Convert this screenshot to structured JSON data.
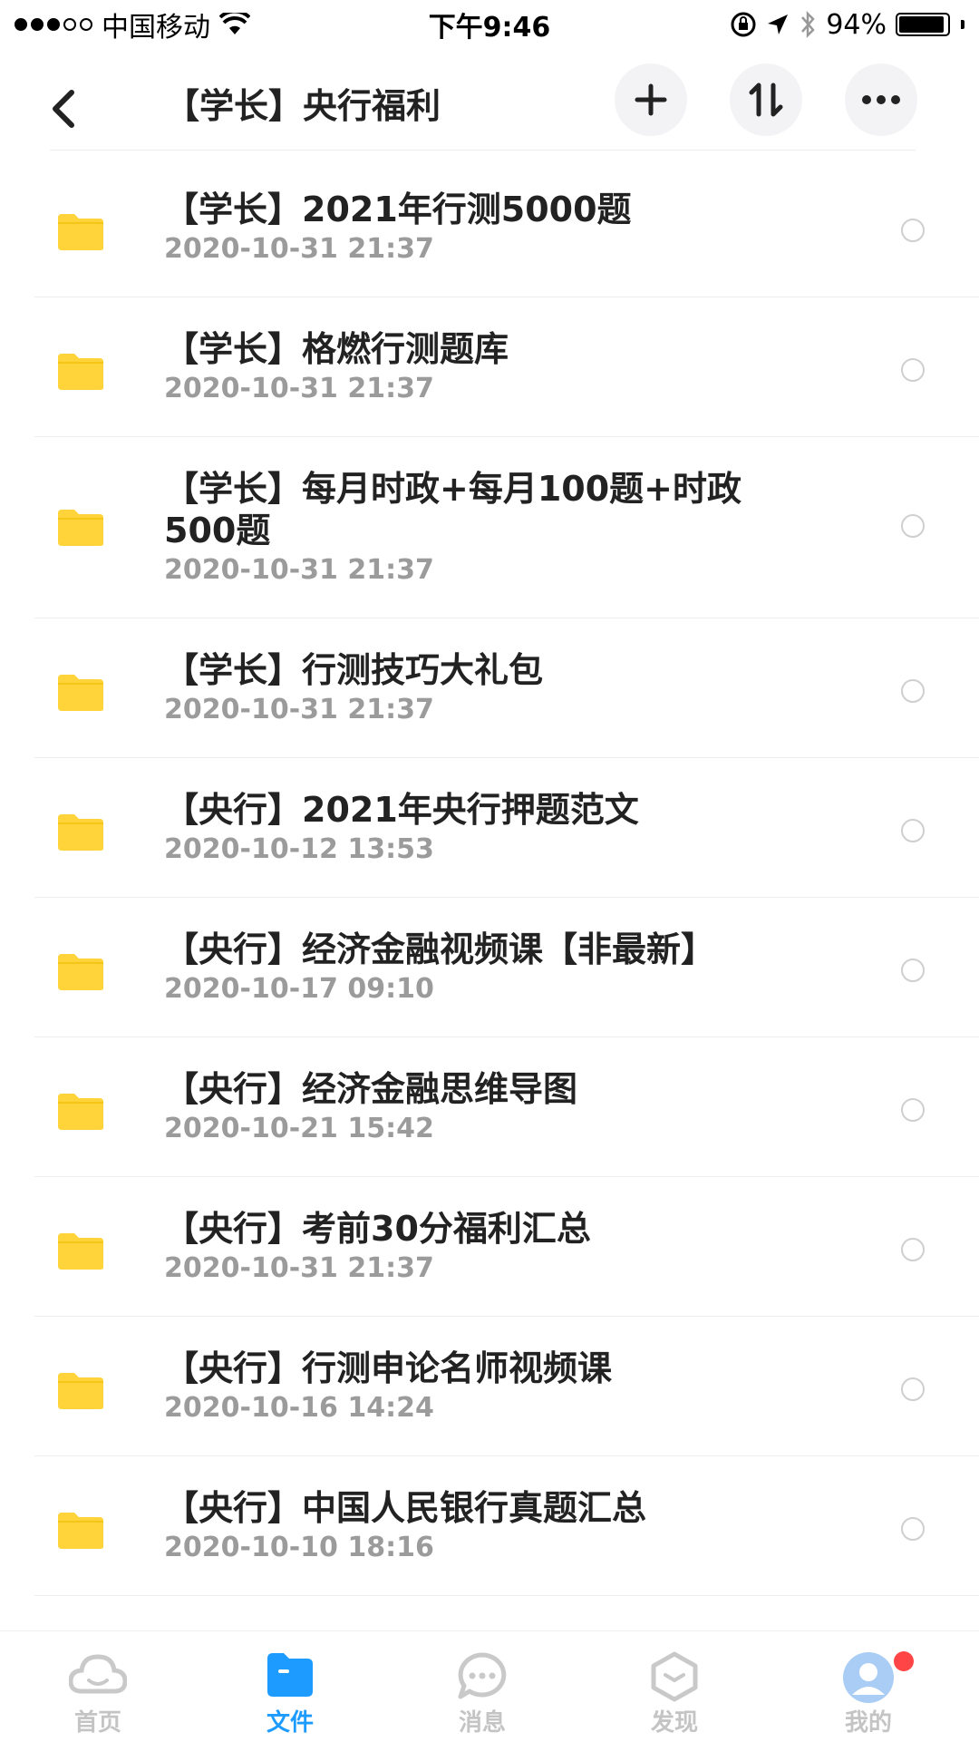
{
  "status_bar": {
    "carrier": "中国移动",
    "time": "下午9:46",
    "battery_percent": "94%",
    "battery_level": 0.94
  },
  "header": {
    "title": "【学长】央行福利"
  },
  "files": [
    {
      "name": "【学长】2021年行测5000题",
      "date": "2020-10-31 21:37"
    },
    {
      "name": "【学长】格燃行测题库",
      "date": "2020-10-31 21:37"
    },
    {
      "name": "【学长】每月时政+每月100题+时政",
      "name2": "500题",
      "date": "2020-10-31 21:37"
    },
    {
      "name": "【学长】行测技巧大礼包",
      "date": "2020-10-31 21:37"
    },
    {
      "name": "【央行】2021年央行押题范文",
      "date": "2020-10-12 13:53"
    },
    {
      "name": "【央行】经济金融视频课【非最新】",
      "date": "2020-10-17 09:10"
    },
    {
      "name": "【央行】经济金融思维导图",
      "date": "2020-10-21 15:42"
    },
    {
      "name": "【央行】考前30分福利汇总",
      "date": "2020-10-31 21:37"
    },
    {
      "name": "【央行】行测申论名师视频课",
      "date": "2020-10-16 14:24"
    },
    {
      "name": "【央行】中国人民银行真题汇总",
      "date": "2020-10-10 18:16"
    }
  ],
  "tabs": [
    {
      "label": "首页",
      "icon": "cloud-icon"
    },
    {
      "label": "文件",
      "icon": "folder-icon",
      "active": true
    },
    {
      "label": "消息",
      "icon": "chat-icon"
    },
    {
      "label": "发现",
      "icon": "discover-icon"
    },
    {
      "label": "我的",
      "icon": "avatar-icon"
    }
  ],
  "colors": {
    "accent": "#1e9bff",
    "folder": "#ffd43b",
    "badge": "#ff4545"
  }
}
